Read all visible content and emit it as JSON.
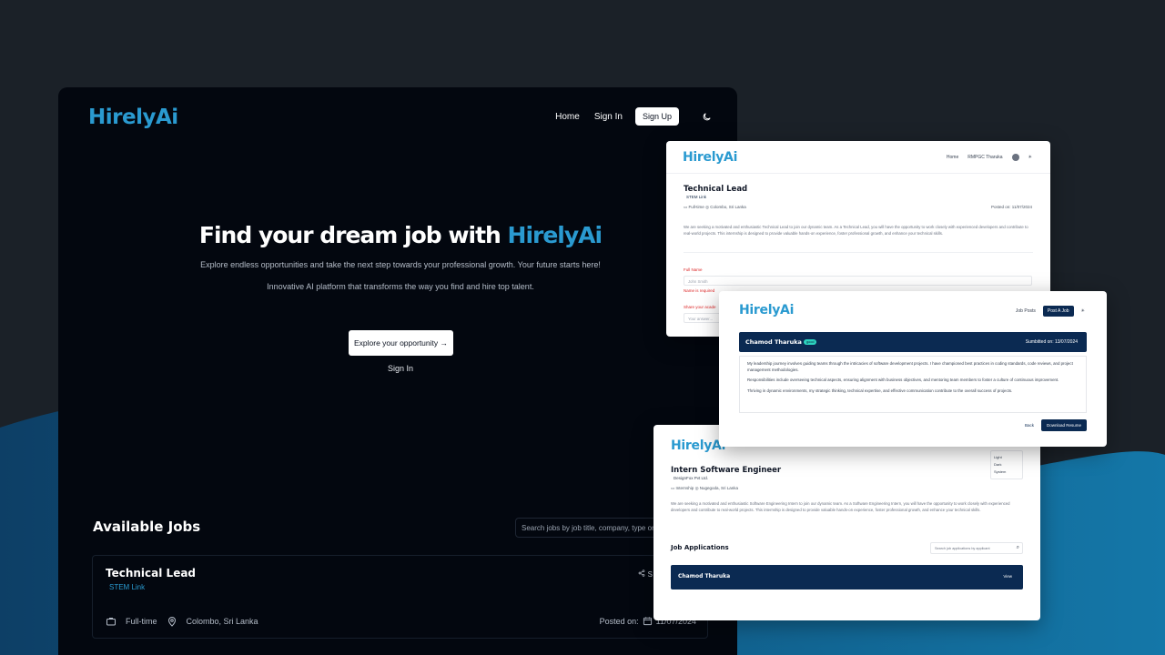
{
  "main": {
    "logo": "HirelyAi",
    "nav": {
      "home": "Home",
      "signin": "Sign In",
      "signup": "Sign Up",
      "theme_icon": "moon-icon"
    },
    "hero": {
      "title_prefix": "Find your dream job with ",
      "title_brand": "HirelyAi",
      "subtitle": "Explore endless opportunities and take the next step towards your professional growth. Your future starts here!",
      "subtitle2": "Innovative AI platform that transforms the way you find and hire top talent.",
      "explore_button": "Explore your opportunity →",
      "signin_link": "Sign In"
    },
    "jobs": {
      "heading": "Available Jobs",
      "search_placeholder": "Search jobs by job title, company, type or",
      "card": {
        "title": "Technical Lead",
        "company": "STEM Link",
        "share": "S",
        "type": "Full-time",
        "location": "Colombo, Sri Lanka",
        "posted_label": "Posted on:",
        "posted_date": "11/07/2024"
      }
    }
  },
  "window_job_apply": {
    "logo": "HirelyAi",
    "nav_home": "Home",
    "nav_user": "RMPGC Tharuka",
    "title": "Technical Lead",
    "company": "STEM Link",
    "type": "Full-time",
    "location": "Colombo, Sri Lanka",
    "posted": "Posted on: 11/07/2024",
    "description": "We are seeking a motivated and enthusiastic Technical Lead to join our dynamic team. As a Technical Lead, you will have the opportunity to work closely with experienced developers and contribute to real-world projects. This internship is designed to provide valuable hands-on experience, foster professional growth, and enhance your technical skills.",
    "full_name_label": "Full Name",
    "full_name_placeholder": "John Smith",
    "name_error": "Name is required",
    "share_label": "Share your acade",
    "share_placeholder": "Your answer..."
  },
  "window_application": {
    "logo": "HirelyAi",
    "nav_jobposts": "Job Posts",
    "nav_post": "Post A Job",
    "applicant": "Chamod Tharuka",
    "badge": "good",
    "submitted": "Sumbitted on: 13/07/2024",
    "p1": "My leadership journey involves guiding teams through the intricacies of software development projects. I have championed best practices in coding standards, code reviews, and project management methodologies.",
    "p2": "Responsibilities include overseeing technical aspects, ensuring alignment with business objectives, and mentoring team members to foster a culture of continuous improvement.",
    "p3": "Thriving in dynamic environments, my strategic thinking, technical expertise, and effective communication contribute to the overall success of projects.",
    "back": "Back",
    "download": "Download Resume"
  },
  "window_job_admin": {
    "logo": "HirelyAi",
    "theme_options": [
      "Light",
      "Dark",
      "System"
    ],
    "title": "Intern Software Engineer",
    "company": "DesignFox Pvt Ltd.",
    "type": "Internship",
    "location": "Nugegoda, Sri Lanka",
    "description": "We are seeking a motivated and enthusiastic Software Engineering Intern to join our dynamic team. As a Software Engineering Intern, you will have the opportunity to work closely with experienced developers and contribute to real-world projects. This internship is designed to provide valuable hands-on experience, foster professional growth, and enhance your technical skills.",
    "applications_heading": "Job Applications",
    "search_placeholder": "Search job applications by applicant",
    "applicant": "Chamod Tharuka",
    "view": "View"
  }
}
